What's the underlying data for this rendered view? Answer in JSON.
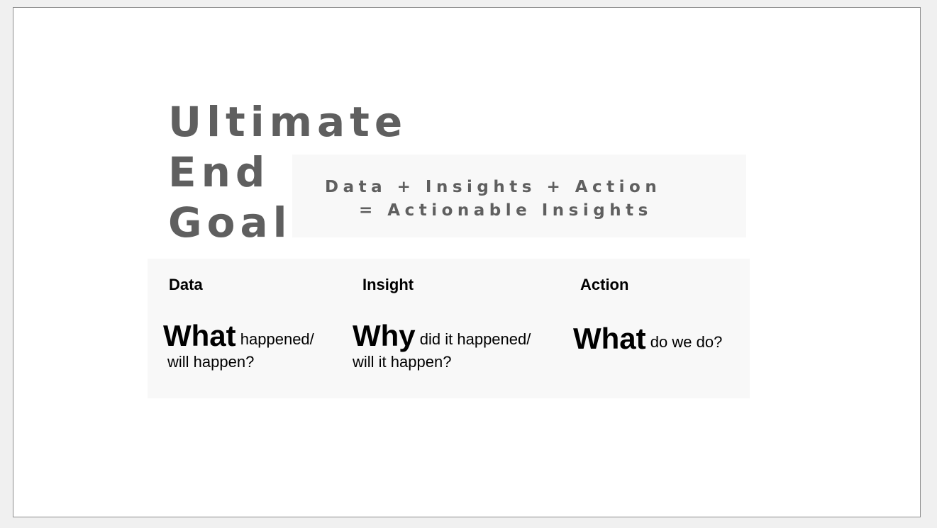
{
  "slide": {
    "title_lines": [
      "Ultimate",
      "End",
      "Goal"
    ],
    "equation": {
      "line1": "Data + Insights + Action",
      "line2": "= Actionable Insights"
    },
    "columns": [
      {
        "heading": "Data",
        "emphasis": "What",
        "rest_line1": "happened/",
        "rest_line2": "will happen?"
      },
      {
        "heading": "Insight",
        "emphasis": "Why",
        "rest_line1": "did it happened/",
        "rest_line2": "will it happen?"
      },
      {
        "heading": "Action",
        "emphasis": "What",
        "rest_line1": "do we do?"
      }
    ]
  },
  "colors": {
    "title": "#5f5f5f",
    "panel": "#f8f8f8",
    "text": "#000000"
  }
}
